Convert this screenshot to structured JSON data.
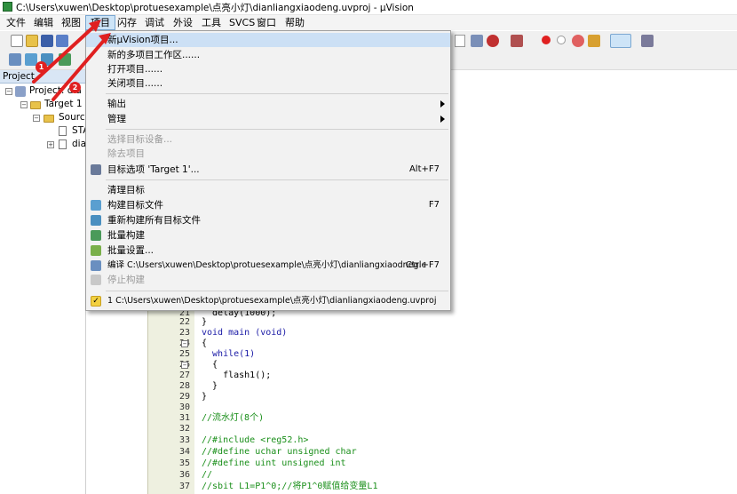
{
  "window": {
    "title": "C:\\Users\\xuwen\\Desktop\\protuesexample\\点亮小灯\\dianliangxiaodeng.uvproj - µVision"
  },
  "menubar": [
    {
      "label": "文件"
    },
    {
      "label": "编辑"
    },
    {
      "label": "视图"
    },
    {
      "label": "项目"
    },
    {
      "label": "闪存"
    },
    {
      "label": "调试"
    },
    {
      "label": "外设"
    },
    {
      "label": "工具"
    },
    {
      "label": "SVCS"
    },
    {
      "label": "窗口"
    },
    {
      "label": "帮助"
    }
  ],
  "project_panel": {
    "header": "Project",
    "root": "Project: dia",
    "target": "Target 1",
    "group": "Source",
    "files": [
      "STA",
      "dian"
    ]
  },
  "dropdown": {
    "items": [
      {
        "label": "新µVision项目...",
        "shortcut": ""
      },
      {
        "label": "新的多项目工作区......",
        "shortcut": ""
      },
      {
        "label": "打开项目......",
        "shortcut": ""
      },
      {
        "label": "关闭项目......",
        "shortcut": ""
      },
      {
        "label": "输出",
        "shortcut": ""
      },
      {
        "label": "管理",
        "shortcut": ""
      },
      {
        "label": "选择目标设备...",
        "shortcut": ""
      },
      {
        "label": "除去项目",
        "shortcut": ""
      },
      {
        "label": "目标选项 'Target 1'...",
        "shortcut": "Alt+F7"
      },
      {
        "label": "清理目标",
        "shortcut": ""
      },
      {
        "label": "构建目标文件",
        "shortcut": "F7"
      },
      {
        "label": "重新构建所有目标文件",
        "shortcut": ""
      },
      {
        "label": "批量构建",
        "shortcut": ""
      },
      {
        "label": "批量设置...",
        "shortcut": ""
      },
      {
        "label": "编译 C:\\Users\\xuwen\\Desktop\\protuesexample\\点亮小灯\\dianliangxiaodneg.c",
        "shortcut": "Ctrl+F7"
      },
      {
        "label": "停止构建",
        "shortcut": ""
      },
      {
        "label": "1 C:\\Users\\xuwen\\Desktop\\protuesexample\\点亮小灯\\dianliangxiaodeng.uvproj",
        "shortcut": ""
      }
    ]
  },
  "annotations": [
    "1",
    "2"
  ],
  "code": [
    {
      "ln": "21",
      "text": "  delay(1000);"
    },
    {
      "ln": "22",
      "text": "}"
    },
    {
      "ln": "23",
      "text": "void main (void)"
    },
    {
      "ln": "24",
      "text": "{"
    },
    {
      "ln": "25",
      "text": "  while(1)"
    },
    {
      "ln": "26",
      "text": "  {"
    },
    {
      "ln": "27",
      "text": "    flash1();"
    },
    {
      "ln": "28",
      "text": "  }"
    },
    {
      "ln": "29",
      "text": "}"
    },
    {
      "ln": "30",
      "text": ""
    },
    {
      "ln": "31",
      "text": "//流水灯(8个)"
    },
    {
      "ln": "32",
      "text": ""
    },
    {
      "ln": "33",
      "text": "//#include <reg52.h>"
    },
    {
      "ln": "34",
      "text": "//#define uchar unsigned char"
    },
    {
      "ln": "35",
      "text": "//#define uint unsigned int"
    },
    {
      "ln": "36",
      "text": "//"
    },
    {
      "ln": "37",
      "text": "//sbit L1=P1^0;//将P1^0赋值给变量L1"
    }
  ],
  "colors": {
    "accent": "#cde4f7",
    "annotation": "#e02020",
    "comment": "#1a8f1a",
    "keyword": "#1a1aa6"
  }
}
